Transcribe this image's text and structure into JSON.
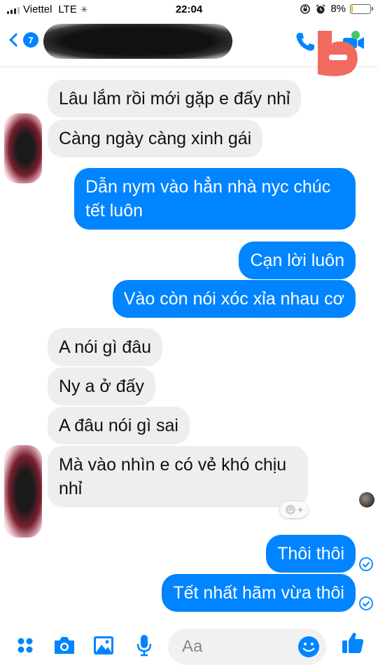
{
  "status_bar": {
    "carrier": "Viettel",
    "network": "LTE",
    "time": "22:04",
    "battery_percent": "8%",
    "battery_level": 0.08
  },
  "header": {
    "unread_count": "7",
    "icons": [
      "back-chevron-icon",
      "phone-icon",
      "video-camera-icon"
    ]
  },
  "messages": [
    {
      "side": "in",
      "text": "Lâu lắm rồi mới gặp e đấy nhỉ"
    },
    {
      "side": "in",
      "text": "Càng ngày càng xinh gái"
    },
    {
      "side": "out",
      "text": "Dẫn nym vào hẳn nhà nyc chúc tết luôn"
    },
    {
      "side": "out",
      "text": "Cạn lời luôn"
    },
    {
      "side": "out",
      "text": "Vào còn nói xóc xỉa nhau cơ"
    },
    {
      "side": "in",
      "text": "A nói gì đâu"
    },
    {
      "side": "in",
      "text": "Ny a ở đấy"
    },
    {
      "side": "in",
      "text": "A đâu nói gì sai"
    },
    {
      "side": "in",
      "text": "Mà vào nhìn e có vẻ khó chịu nhỉ"
    },
    {
      "side": "out",
      "text": "Thôi thôi"
    },
    {
      "side": "out",
      "text": "Tết nhất hãm vừa thôi"
    }
  ],
  "composer": {
    "placeholder": "Aa",
    "icons": [
      "menu-dots-icon",
      "camera-icon",
      "image-icon",
      "microphone-icon",
      "emoji-icon",
      "thumbs-up-icon"
    ]
  },
  "colors": {
    "accent": "#0084ff",
    "incoming_bubble": "#eeeeee",
    "outgoing_bubble": "#0084ff",
    "logo": "#f26a5e"
  }
}
